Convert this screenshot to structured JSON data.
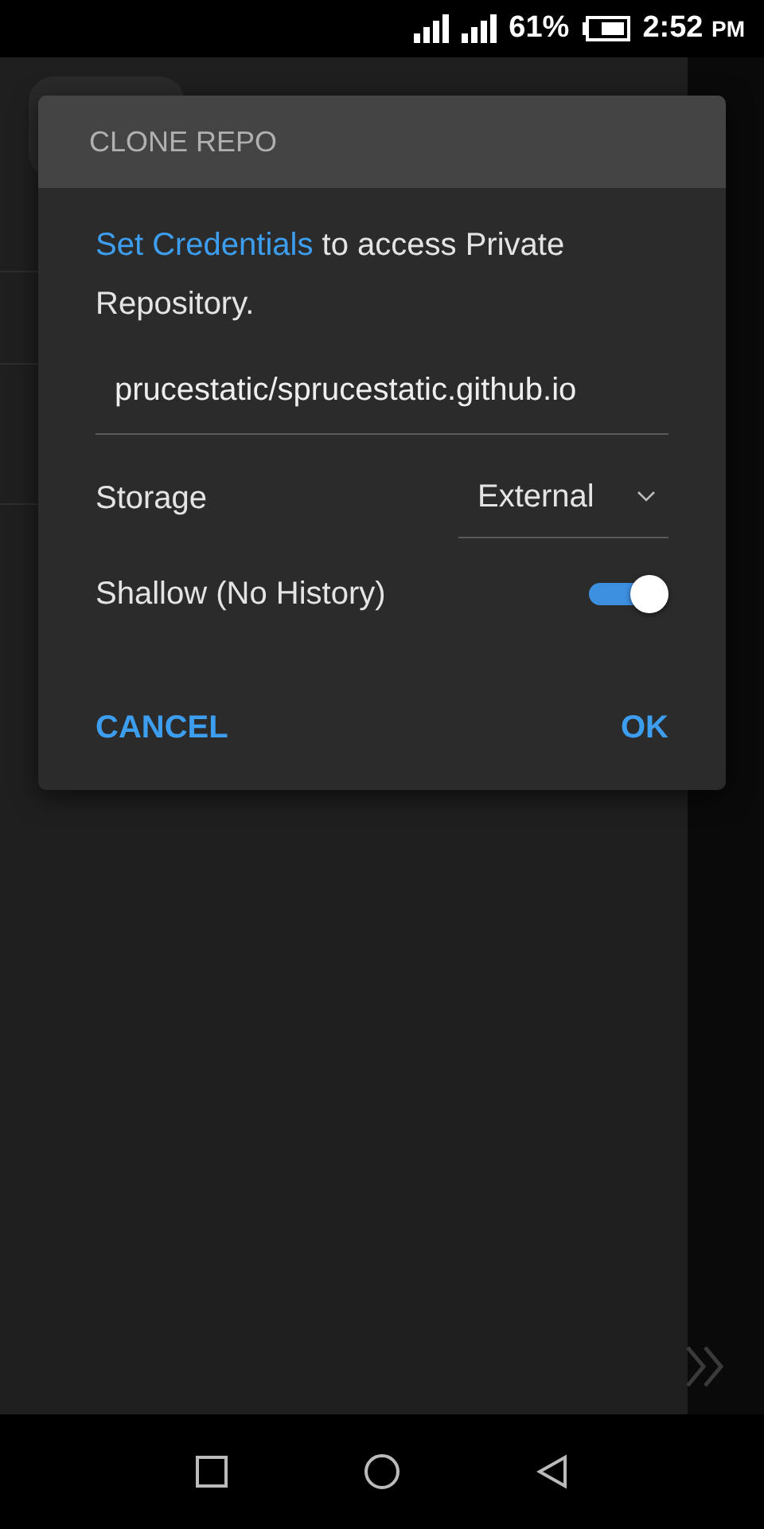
{
  "status_bar": {
    "battery": "61%",
    "time": "2:52",
    "meridiem": "PM"
  },
  "dialog": {
    "title": "CLONE REPO",
    "message": {
      "link": "Set Credentials",
      "text": "to access Private Repository."
    },
    "repo_field": {
      "value": "prucestatic/sprucestatic.github.io"
    },
    "storage": {
      "label": "Storage",
      "value": "External"
    },
    "shallow": {
      "label": "Shallow (No History)",
      "on": true
    },
    "buttons": [
      {
        "label": "CANCEL"
      },
      {
        "label": "OK"
      }
    ]
  }
}
